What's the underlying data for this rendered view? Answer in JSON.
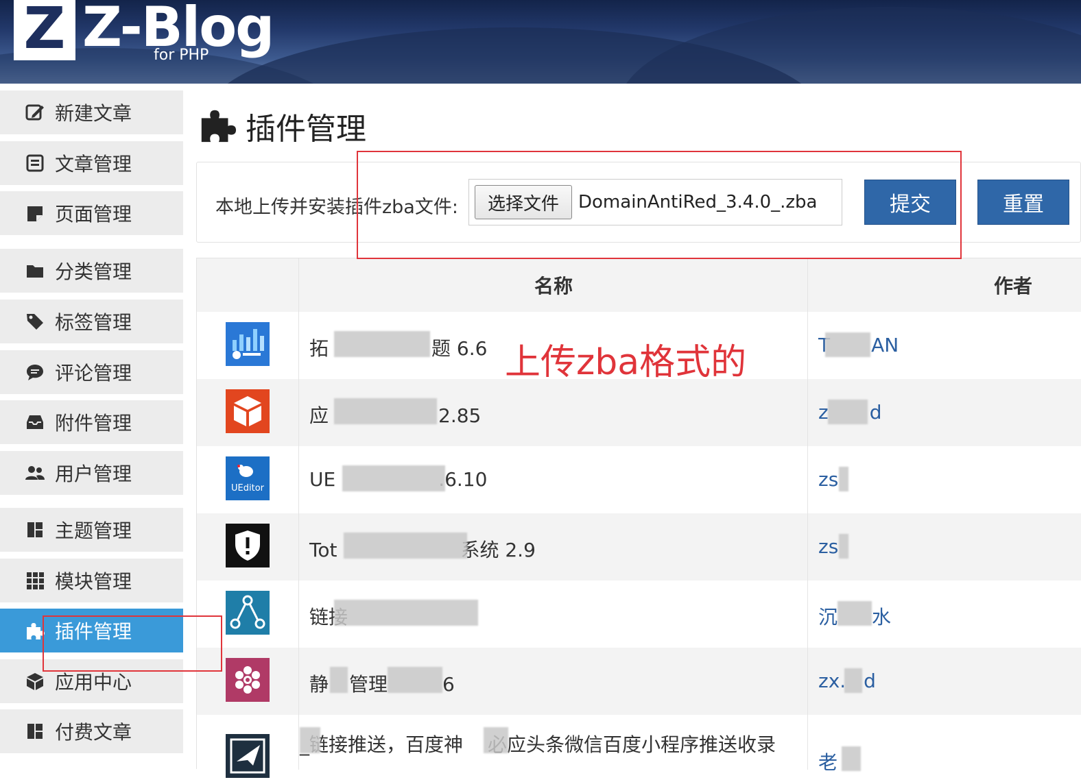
{
  "header": {
    "logo_letter": "Z",
    "logo_text": "Z-Blog",
    "logo_sub": "for PHP"
  },
  "sidebar": {
    "items": [
      {
        "label": "新建文章",
        "icon": "edit-icon"
      },
      {
        "label": "文章管理",
        "icon": "article-list-icon"
      },
      {
        "label": "页面管理",
        "icon": "page-icon"
      },
      {
        "label": "分类管理",
        "icon": "folder-icon"
      },
      {
        "label": "标签管理",
        "icon": "tag-icon"
      },
      {
        "label": "评论管理",
        "icon": "comment-icon"
      },
      {
        "label": "附件管理",
        "icon": "inbox-icon"
      },
      {
        "label": "用户管理",
        "icon": "users-icon"
      },
      {
        "label": "主题管理",
        "icon": "theme-icon"
      },
      {
        "label": "模块管理",
        "icon": "grid-icon"
      },
      {
        "label": "插件管理",
        "icon": "puzzle-icon",
        "active": true
      },
      {
        "label": "应用中心",
        "icon": "box-icon"
      },
      {
        "label": "付费文章",
        "icon": "theme-icon"
      }
    ]
  },
  "main": {
    "title": "插件管理",
    "upload": {
      "label": "本地上传并安装插件zba文件:",
      "choose_button": "选择文件",
      "file_name": "DomainAntiRed_3.4.0_.zba",
      "submit": "提交",
      "reset": "重置"
    },
    "annotation": "上传zba格式的",
    "table": {
      "columns": [
        "名称",
        "作者"
      ],
      "rows": [
        {
          "name": "拓",
          "name_tail": "题 6.6",
          "author": "T",
          "author_tail": "AN",
          "icon": "theme-blue-icon"
        },
        {
          "name": "应",
          "name_tail": "2.85",
          "author": "z",
          "author_tail": "d",
          "icon": "cube-orange-icon"
        },
        {
          "name": "UE",
          "name_tail": ".6.10",
          "author": "zs",
          "author_tail": "",
          "icon": "ueditor-icon"
        },
        {
          "name": "Tot",
          "name_tail": "系统 2.9",
          "author": "zs",
          "author_tail": "",
          "icon": "shield-alert-icon"
        },
        {
          "name": "链接",
          "name_tail": "",
          "author": "沉",
          "author_tail": "水",
          "icon": "share-nodes-icon"
        },
        {
          "name": "静",
          "name_tail": "管理",
          "name_tail2": "6",
          "author": "zx.",
          "author_tail": "d",
          "icon": "hexagon-flower-icon"
        },
        {
          "name": "_链接推送，百度神",
          "name_tail": "必应头条微信百度小程序推送收录",
          "author": "老",
          "author_tail": "",
          "icon": "send-board-icon"
        }
      ],
      "ueditor_badge": "UEditor"
    }
  },
  "colors": {
    "accent": "#3a9ad9",
    "button": "#2f67a8",
    "annotation": "#e0343a",
    "link": "#2b5fa1"
  }
}
